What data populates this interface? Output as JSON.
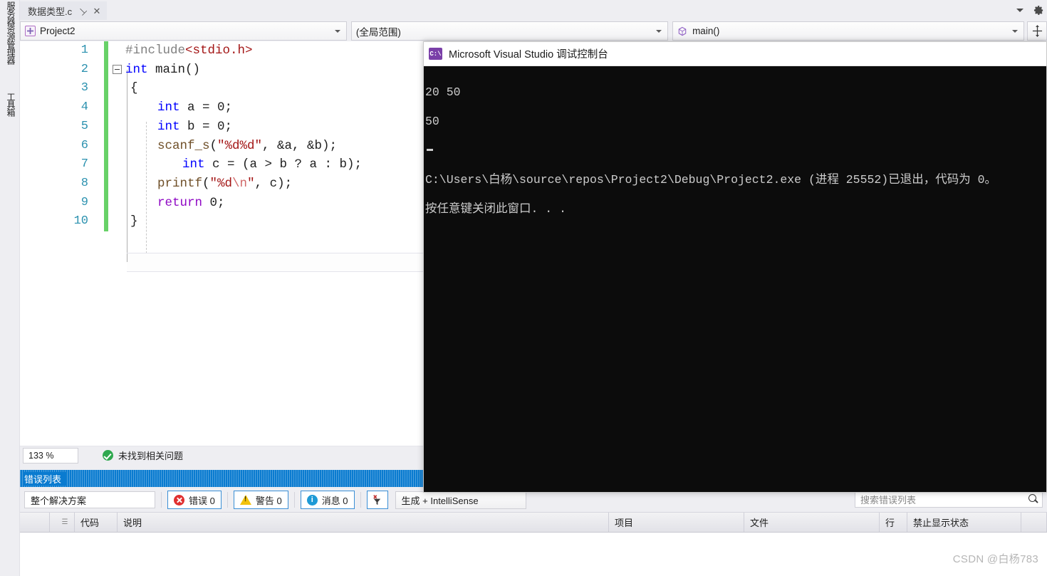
{
  "left_dock": {
    "items": [
      {
        "label": "服务器资源管理器",
        "name": "server-explorer"
      },
      {
        "label": "工具箱",
        "name": "toolbox"
      }
    ]
  },
  "tabstrip": {
    "document_tab": {
      "title": "数据类型.c",
      "pin_icon": "pin-icon",
      "close_icon": "close-icon",
      "close_glyph": "✕",
      "pin_glyph": "⊣"
    },
    "overflow_chevron_icon": "chevron-down-icon",
    "settings_icon": "gear-icon"
  },
  "navbar": {
    "project": {
      "label": "Project2",
      "icon": "project-icon"
    },
    "scope": {
      "label": "(全局范围)"
    },
    "member": {
      "label": "main()",
      "icon": "method-icon"
    },
    "split_view_icon": "split-view-icon"
  },
  "editor": {
    "line_numbers": [
      "1",
      "2",
      "3",
      "4",
      "5",
      "6",
      "7",
      "8",
      "9",
      "10"
    ],
    "zoom_level": "133 %",
    "code_lines": [
      "#include<stdio.h>",
      "int main()",
      "{",
      "    int a = 0;",
      "    int b = 0;",
      "    scanf_s(\"%d%d\", &a, &b);",
      "        int c = (a > b ? a : b);",
      "    printf(\"%d\\n\", c);",
      "    return 0;",
      "}"
    ],
    "tokens": {
      "l1_hash_include": "#include",
      "l1_header": "<stdio.h>",
      "l2_int": "int",
      "l2_main": " main()",
      "l3_brace": "{",
      "l4_int": "int",
      "l4_rest": " a = 0;",
      "l5_int": "int",
      "l5_rest": " b = 0;",
      "l6_fn": "scanf_s",
      "l6_open": "(",
      "l6_str": "\"%d%d\"",
      "l6_rest": ", &a, &b);",
      "l7_int": "int",
      "l7_rest": " c = (a > b ? a : b);",
      "l8_fn": "printf",
      "l8_open": "(",
      "l8_str": "\"%d",
      "l8_esc": "\\n",
      "l8_str2": "\"",
      "l8_rest": ", c);",
      "l9_return": "return",
      "l9_rest": " 0;",
      "l10_brace": "}"
    }
  },
  "status": {
    "issue_text": "未找到相关问题",
    "issue_icon": "check-circle-icon"
  },
  "error_list": {
    "panel_title": "错误列表",
    "scope_filter": "整个解决方案",
    "errors_label": "错误 0",
    "warnings_label": "警告 0",
    "messages_label": "消息 0",
    "clear_filter_icon": "clear-filter-icon",
    "build_filter": "生成 + IntelliSense",
    "search_placeholder": "搜索错误列表",
    "search_icon": "search-icon",
    "columns": [
      "",
      "",
      "代码",
      "说明",
      "项目",
      "文件",
      "行",
      "禁止显示状态"
    ],
    "rows": []
  },
  "console": {
    "title": "Microsoft Visual Studio 调试控制台",
    "icon": "console-icon",
    "icon_glyph": "C:\\",
    "output_lines": [
      "20 50",
      "50",
      "",
      "C:\\Users\\白杨\\source\\repos\\Project2\\Debug\\Project2.exe (进程 25552)已退出，代码为 0。",
      "按任意键关闭此窗口. . ."
    ]
  },
  "watermark": {
    "text": "CSDN @白杨783"
  },
  "colors": {
    "accent_blue": "#0a7bd0",
    "keyword_blue": "#0000ff",
    "string_red": "#a31515",
    "linenum_teal": "#2b91af",
    "change_green": "#68d168",
    "console_bg": "#0c0c0c",
    "chrome_bg": "#eeeef2"
  }
}
